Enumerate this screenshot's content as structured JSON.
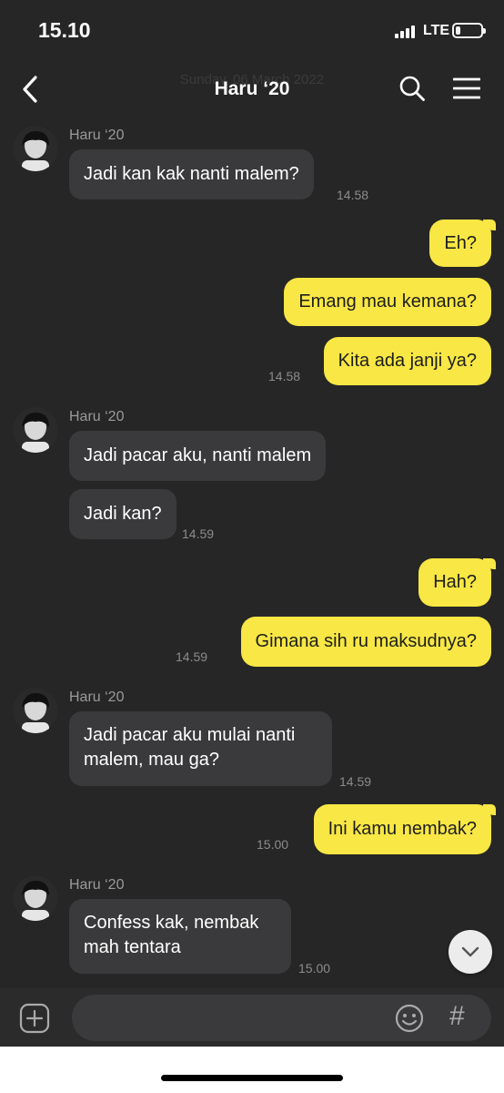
{
  "status_bar": {
    "time": "15.10",
    "network": "LTE"
  },
  "header": {
    "title": "Haru ‘20",
    "date_ghost": "Sunday, 06 March 2022"
  },
  "messages": [
    {
      "side": "in",
      "sender": "Haru ‘20",
      "text": "Jadi kan kak nanti malem?",
      "time": "14.58"
    },
    {
      "side": "out",
      "text": "Eh?"
    },
    {
      "side": "out",
      "text": "Emang mau kemana?"
    },
    {
      "side": "out",
      "text": "Kita ada janji ya?",
      "time": "14.58"
    },
    {
      "side": "in",
      "sender": "Haru ‘20",
      "text": "Jadi pacar aku, nanti malem"
    },
    {
      "side": "in",
      "text": "Jadi kan?",
      "time": "14.59"
    },
    {
      "side": "out",
      "text": "Hah?"
    },
    {
      "side": "out",
      "text": "Gimana sih ru maksudnya?",
      "time": "14.59"
    },
    {
      "side": "in",
      "sender": "Haru ‘20",
      "text": "Jadi pacar aku mulai nanti malem, mau ga?",
      "time": "14.59"
    },
    {
      "side": "out",
      "text": "Ini kamu nembak?",
      "time": "15.00"
    },
    {
      "side": "in",
      "sender": "Haru ‘20",
      "text": "Confess kak, nembak mah tentara",
      "time": "15.00"
    }
  ],
  "input": {
    "placeholder": "",
    "hash_symbol": "#"
  },
  "icons": [
    "back-icon",
    "search-icon",
    "menu-icon",
    "plus-icon",
    "emoji-icon",
    "hash-icon",
    "chevron-down-icon"
  ],
  "colors": {
    "background": "#262626",
    "incoming_bubble": "#3a3a3c",
    "outgoing_bubble": "#f8e744"
  }
}
